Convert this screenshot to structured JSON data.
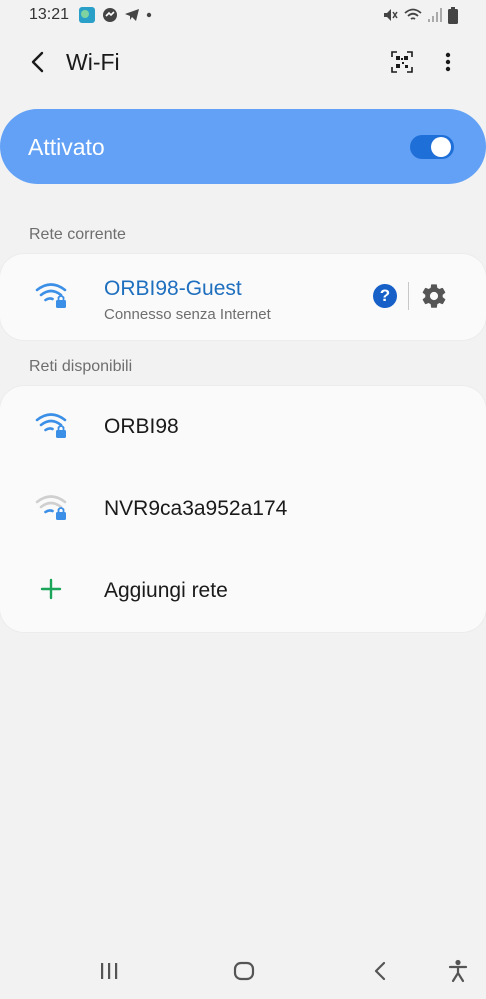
{
  "status_bar": {
    "time": "13:21"
  },
  "app_bar": {
    "title": "Wi-Fi"
  },
  "master_switch": {
    "label": "Attivato",
    "state": "on"
  },
  "current_section": {
    "header": "Rete corrente"
  },
  "current_network": {
    "name": "ORBI98-Guest",
    "status": "Connesso senza Internet",
    "help_glyph": "?"
  },
  "available_section": {
    "header": "Reti disponibili"
  },
  "networks": [
    {
      "name": "ORBI98",
      "signal": "strong"
    },
    {
      "name": "NVR9ca3a952a174",
      "signal": "weak"
    }
  ],
  "add_network": {
    "label": "Aggiungi rete"
  },
  "colors": {
    "accent": "#62a1f5",
    "link": "#1f6fbf",
    "wifi": "#3b8fe6",
    "add": "#1aa55a"
  }
}
